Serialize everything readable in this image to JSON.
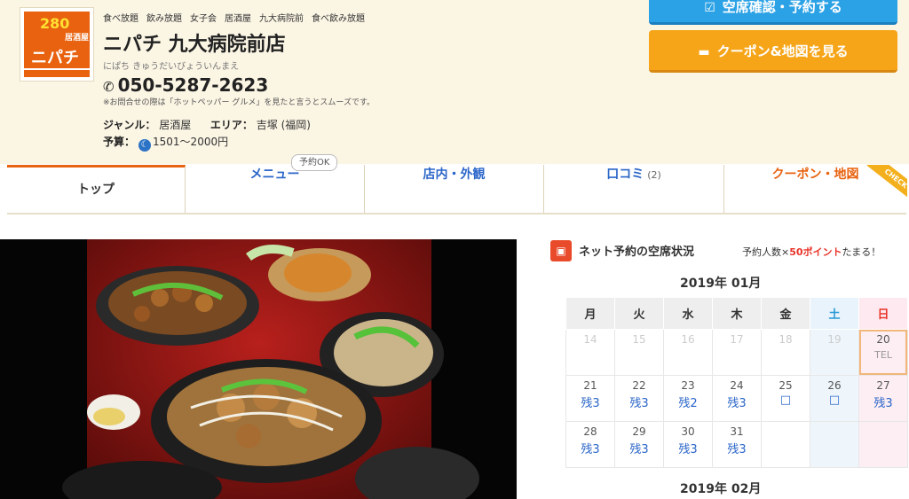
{
  "header": {
    "tags": [
      "食べ放題",
      "飲み放題",
      "女子会",
      "居酒屋",
      "九大病院前",
      "食べ飲み放題"
    ],
    "shop_name": "ニパチ 九大病院前店",
    "shop_kana": "にぱち きゅうだいびょういんまえ",
    "phone": "050-5287-2623",
    "phone_note": "※お問合せの際は「ホットペッパー グルメ」を見たと言うとスムーズです。",
    "genre_label": "ジャンル：",
    "genre": "居酒屋",
    "area_label": "エリア：",
    "area": "吉塚 (福岡)",
    "budget_label": "予算：",
    "budget": "1501～2000円",
    "logo": {
      "number": "280",
      "sub": "居酒屋",
      "name": "ニパチ"
    }
  },
  "buttons": {
    "reserve": "空席確認・予約する",
    "coupon_map": "クーポン&地図を見る"
  },
  "tabs": [
    {
      "label": "トップ"
    },
    {
      "label": "メニュー"
    },
    {
      "label": "店内・外観"
    },
    {
      "label": "口コミ",
      "count": "(2)"
    },
    {
      "label": "クーポン・地図"
    }
  ],
  "menu_badge": "予約OK",
  "check_badge": "CHECK",
  "calendar": {
    "title": "ネット予約の空席状況",
    "point_prefix": "予約人数×",
    "point_highlight": "50ポイント",
    "point_suffix": "たまる！",
    "month": "2019年 01月",
    "next_month": "2019年 02月",
    "weekdays": [
      "月",
      "火",
      "水",
      "木",
      "金",
      "土",
      "日"
    ],
    "weeks": [
      [
        {
          "d": "14",
          "s": "",
          "past": true
        },
        {
          "d": "15",
          "s": "",
          "past": true
        },
        {
          "d": "16",
          "s": "",
          "past": true
        },
        {
          "d": "17",
          "s": "",
          "past": true
        },
        {
          "d": "18",
          "s": "",
          "past": true
        },
        {
          "d": "19",
          "s": "",
          "past": true
        },
        {
          "d": "20",
          "s": "TEL",
          "today": true
        }
      ],
      [
        {
          "d": "21",
          "s": "残3"
        },
        {
          "d": "22",
          "s": "残3"
        },
        {
          "d": "23",
          "s": "残2"
        },
        {
          "d": "24",
          "s": "残3"
        },
        {
          "d": "25",
          "s": "□"
        },
        {
          "d": "26",
          "s": "□"
        },
        {
          "d": "27",
          "s": "残3"
        }
      ],
      [
        {
          "d": "28",
          "s": "残3"
        },
        {
          "d": "29",
          "s": "残3"
        },
        {
          "d": "30",
          "s": "残3"
        },
        {
          "d": "31",
          "s": "残3"
        },
        {
          "d": "",
          "s": ""
        },
        {
          "d": "",
          "s": ""
        },
        {
          "d": "",
          "s": ""
        }
      ]
    ]
  },
  "colors": {
    "accent_orange": "#e8620f",
    "link_blue": "#2b66c9",
    "reserve_blue": "#2ca2e6",
    "coupon_orange": "#f6a519"
  }
}
